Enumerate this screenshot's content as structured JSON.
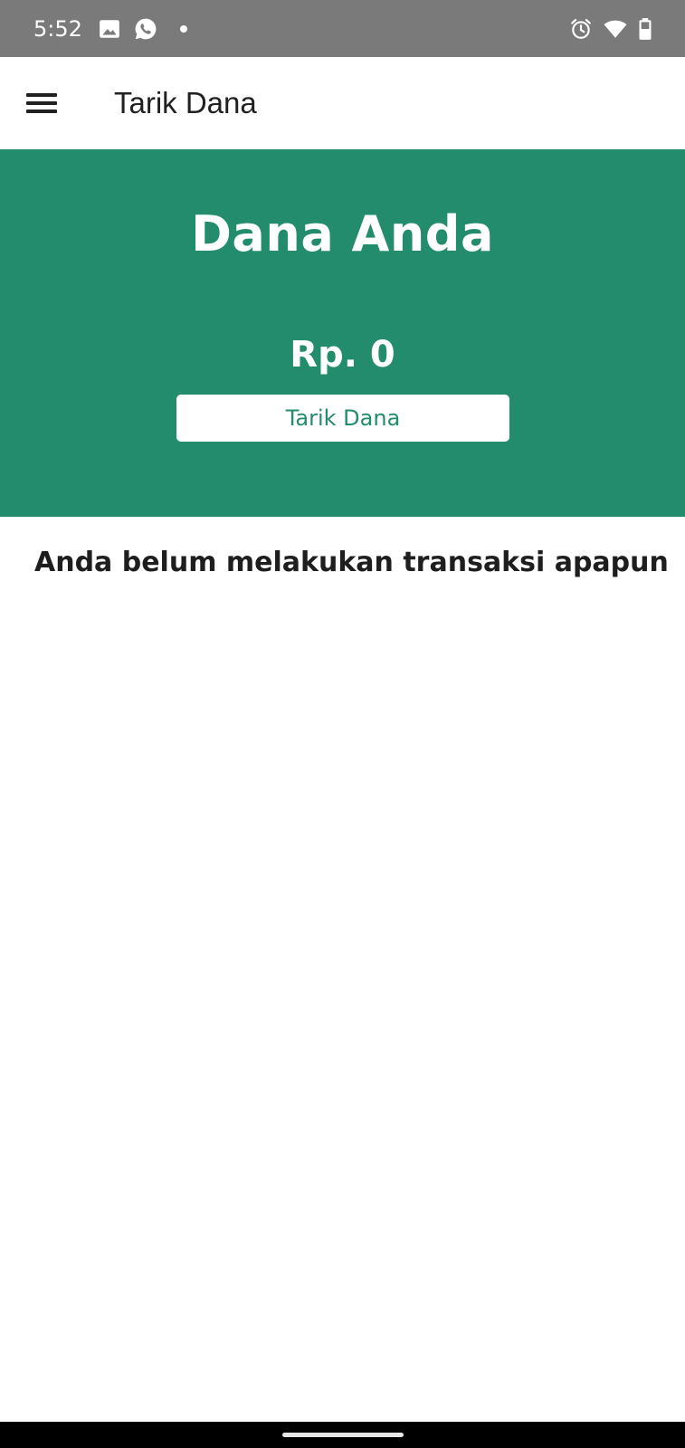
{
  "status_bar": {
    "time": "5:52",
    "icons": [
      "image-icon",
      "whatsapp-icon",
      "notification-dot-icon",
      "alarm-icon",
      "wifi-icon",
      "battery-icon"
    ]
  },
  "app_bar": {
    "title": "Tarik Dana",
    "menu_icon": "hamburger-menu-icon"
  },
  "balance": {
    "heading": "Dana Anda",
    "amount": "Rp. 0",
    "withdraw_label": "Tarik Dana"
  },
  "transactions": {
    "empty_message": "Anda belum melakukan transaksi apapun"
  },
  "colors": {
    "primary": "#228c6c",
    "status_bar": "#7a7a7a",
    "text_dark": "#212121",
    "background": "#ffffff"
  }
}
